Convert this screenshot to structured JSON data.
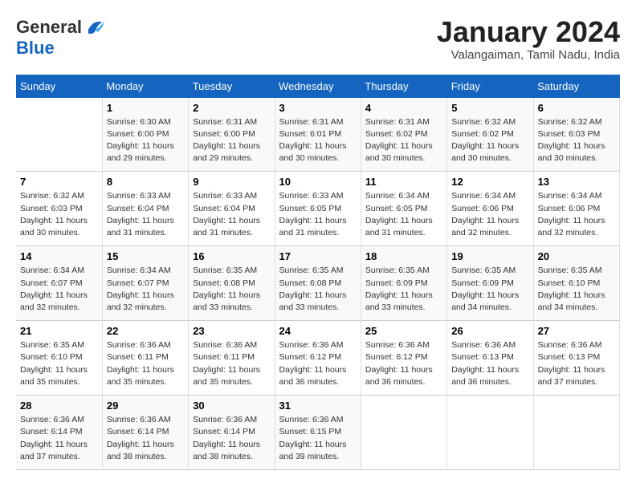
{
  "logo": {
    "general": "General",
    "blue": "Blue"
  },
  "header": {
    "title": "January 2024",
    "subtitle": "Valangaiman, Tamil Nadu, India"
  },
  "days_of_week": [
    "Sunday",
    "Monday",
    "Tuesday",
    "Wednesday",
    "Thursday",
    "Friday",
    "Saturday"
  ],
  "weeks": [
    [
      {
        "num": "",
        "info": ""
      },
      {
        "num": "1",
        "info": "Sunrise: 6:30 AM\nSunset: 6:00 PM\nDaylight: 11 hours\nand 29 minutes."
      },
      {
        "num": "2",
        "info": "Sunrise: 6:31 AM\nSunset: 6:00 PM\nDaylight: 11 hours\nand 29 minutes."
      },
      {
        "num": "3",
        "info": "Sunrise: 6:31 AM\nSunset: 6:01 PM\nDaylight: 11 hours\nand 30 minutes."
      },
      {
        "num": "4",
        "info": "Sunrise: 6:31 AM\nSunset: 6:02 PM\nDaylight: 11 hours\nand 30 minutes."
      },
      {
        "num": "5",
        "info": "Sunrise: 6:32 AM\nSunset: 6:02 PM\nDaylight: 11 hours\nand 30 minutes."
      },
      {
        "num": "6",
        "info": "Sunrise: 6:32 AM\nSunset: 6:03 PM\nDaylight: 11 hours\nand 30 minutes."
      }
    ],
    [
      {
        "num": "7",
        "info": "Sunrise: 6:32 AM\nSunset: 6:03 PM\nDaylight: 11 hours\nand 30 minutes."
      },
      {
        "num": "8",
        "info": "Sunrise: 6:33 AM\nSunset: 6:04 PM\nDaylight: 11 hours\nand 31 minutes."
      },
      {
        "num": "9",
        "info": "Sunrise: 6:33 AM\nSunset: 6:04 PM\nDaylight: 11 hours\nand 31 minutes."
      },
      {
        "num": "10",
        "info": "Sunrise: 6:33 AM\nSunset: 6:05 PM\nDaylight: 11 hours\nand 31 minutes."
      },
      {
        "num": "11",
        "info": "Sunrise: 6:34 AM\nSunset: 6:05 PM\nDaylight: 11 hours\nand 31 minutes."
      },
      {
        "num": "12",
        "info": "Sunrise: 6:34 AM\nSunset: 6:06 PM\nDaylight: 11 hours\nand 32 minutes."
      },
      {
        "num": "13",
        "info": "Sunrise: 6:34 AM\nSunset: 6:06 PM\nDaylight: 11 hours\nand 32 minutes."
      }
    ],
    [
      {
        "num": "14",
        "info": "Sunrise: 6:34 AM\nSunset: 6:07 PM\nDaylight: 11 hours\nand 32 minutes."
      },
      {
        "num": "15",
        "info": "Sunrise: 6:34 AM\nSunset: 6:07 PM\nDaylight: 11 hours\nand 32 minutes."
      },
      {
        "num": "16",
        "info": "Sunrise: 6:35 AM\nSunset: 6:08 PM\nDaylight: 11 hours\nand 33 minutes."
      },
      {
        "num": "17",
        "info": "Sunrise: 6:35 AM\nSunset: 6:08 PM\nDaylight: 11 hours\nand 33 minutes."
      },
      {
        "num": "18",
        "info": "Sunrise: 6:35 AM\nSunset: 6:09 PM\nDaylight: 11 hours\nand 33 minutes."
      },
      {
        "num": "19",
        "info": "Sunrise: 6:35 AM\nSunset: 6:09 PM\nDaylight: 11 hours\nand 34 minutes."
      },
      {
        "num": "20",
        "info": "Sunrise: 6:35 AM\nSunset: 6:10 PM\nDaylight: 11 hours\nand 34 minutes."
      }
    ],
    [
      {
        "num": "21",
        "info": "Sunrise: 6:35 AM\nSunset: 6:10 PM\nDaylight: 11 hours\nand 35 minutes."
      },
      {
        "num": "22",
        "info": "Sunrise: 6:36 AM\nSunset: 6:11 PM\nDaylight: 11 hours\nand 35 minutes."
      },
      {
        "num": "23",
        "info": "Sunrise: 6:36 AM\nSunset: 6:11 PM\nDaylight: 11 hours\nand 35 minutes."
      },
      {
        "num": "24",
        "info": "Sunrise: 6:36 AM\nSunset: 6:12 PM\nDaylight: 11 hours\nand 36 minutes."
      },
      {
        "num": "25",
        "info": "Sunrise: 6:36 AM\nSunset: 6:12 PM\nDaylight: 11 hours\nand 36 minutes."
      },
      {
        "num": "26",
        "info": "Sunrise: 6:36 AM\nSunset: 6:13 PM\nDaylight: 11 hours\nand 36 minutes."
      },
      {
        "num": "27",
        "info": "Sunrise: 6:36 AM\nSunset: 6:13 PM\nDaylight: 11 hours\nand 37 minutes."
      }
    ],
    [
      {
        "num": "28",
        "info": "Sunrise: 6:36 AM\nSunset: 6:14 PM\nDaylight: 11 hours\nand 37 minutes."
      },
      {
        "num": "29",
        "info": "Sunrise: 6:36 AM\nSunset: 6:14 PM\nDaylight: 11 hours\nand 38 minutes."
      },
      {
        "num": "30",
        "info": "Sunrise: 6:36 AM\nSunset: 6:14 PM\nDaylight: 11 hours\nand 38 minutes."
      },
      {
        "num": "31",
        "info": "Sunrise: 6:36 AM\nSunset: 6:15 PM\nDaylight: 11 hours\nand 39 minutes."
      },
      {
        "num": "",
        "info": ""
      },
      {
        "num": "",
        "info": ""
      },
      {
        "num": "",
        "info": ""
      }
    ]
  ]
}
